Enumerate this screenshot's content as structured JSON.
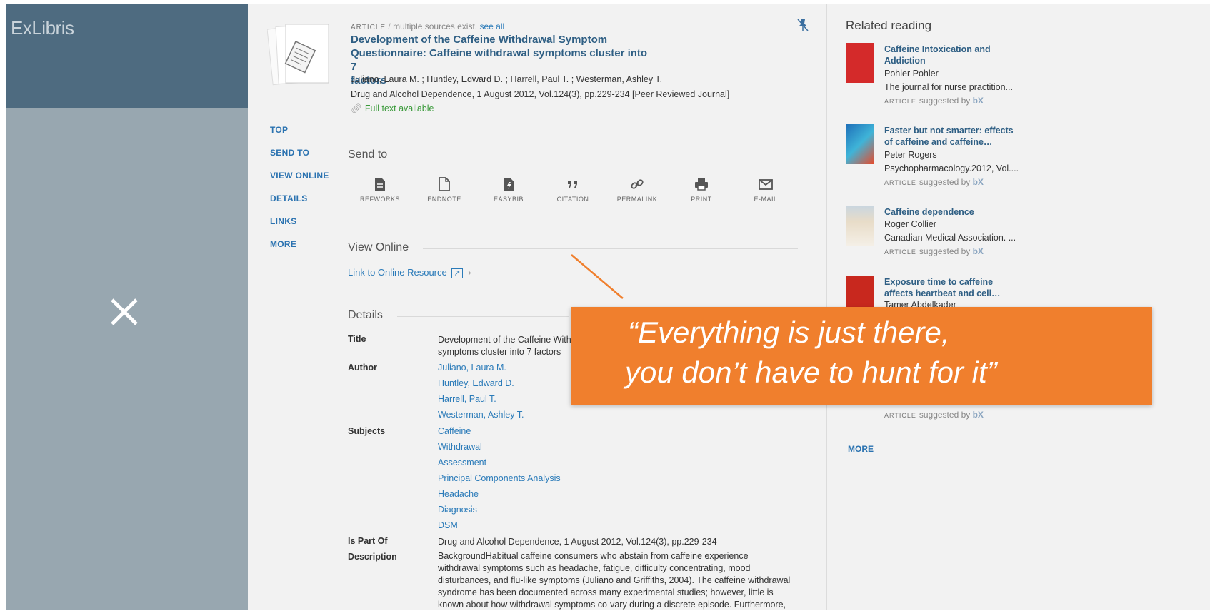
{
  "logo": {
    "text": "ExLibris"
  },
  "record": {
    "type_label": "ARTICLE",
    "sources_text": "multiple sources exist.",
    "see_all": "see all",
    "title_lines": [
      "Development of the Caffeine Withdrawal Symptom",
      "Questionnaire: Caffeine withdrawal symptoms cluster into 7",
      "factors"
    ],
    "authors": "Juliano, Laura M. ; Huntley, Edward D. ; Harrell, Paul T. ; Westerman, Ashley T.",
    "source": "Drug and Alcohol Dependence, 1 August 2012, Vol.124(3), pp.229-234 [Peer Reviewed Journal]",
    "availability": "Full text available"
  },
  "nav": {
    "items": [
      "TOP",
      "SEND TO",
      "VIEW ONLINE",
      "DETAILS",
      "LINKS",
      "MORE"
    ]
  },
  "send_to": {
    "heading": "Send to",
    "items": [
      {
        "label": "REFWORKS",
        "icon": "document-filled-icon"
      },
      {
        "label": "ENDNOTE",
        "icon": "document-outline-icon"
      },
      {
        "label": "EASYBIB",
        "icon": "easybib-icon"
      },
      {
        "label": "CITATION",
        "icon": "quote-icon"
      },
      {
        "label": "PERMALINK",
        "icon": "link-icon"
      },
      {
        "label": "PRINT",
        "icon": "printer-icon"
      },
      {
        "label": "E-MAIL",
        "icon": "mail-icon"
      }
    ]
  },
  "view_online": {
    "heading": "View Online",
    "link": "Link to Online Resource"
  },
  "details": {
    "heading": "Details",
    "title_label": "Title",
    "title_value_lines": [
      "Development of the Caffeine With",
      "symptoms cluster into 7 factors"
    ],
    "author_label": "Author",
    "authors": [
      "Juliano, Laura M.",
      "Huntley, Edward D.",
      "Harrell, Paul T.",
      "Westerman, Ashley T."
    ],
    "subjects_label": "Subjects",
    "subjects": [
      "Caffeine",
      "Withdrawal",
      "Assessment",
      "Principal Components Analysis",
      "Headache",
      "Diagnosis",
      "DSM"
    ],
    "is_part_of_label": "Is Part Of",
    "is_part_of": "Drug and Alcohol Dependence, 1 August 2012, Vol.124(3), pp.229-234",
    "description_label": "Description",
    "description_lines": [
      "BackgroundHabitual caffeine consumers who abstain from caffeine experience",
      "withdrawal symptoms such as headache, fatigue, difficulty concentrating, mood",
      "disturbances, and flu-like symptoms (Juliano and Griffiths, 2004). The caffeine withdrawal",
      "syndrome has been documented across many experimental studies; however, little is",
      "known about how withdrawal symptoms co-vary during a discrete episode. Furthermore,"
    ]
  },
  "related": {
    "heading": "Related reading",
    "items": [
      {
        "title_lines": [
          "Caffeine Intoxication and",
          "Addiction"
        ],
        "author": "Pohler Pohler",
        "source": "The journal for nurse practition...",
        "type": "ARTICLE",
        "suggested": "suggested by",
        "bx": "bX",
        "cover_color": "#d42a2a"
      },
      {
        "title_lines": [
          "Faster but not smarter: effects",
          "of caffeine and caffeine…"
        ],
        "author": "Peter Rogers",
        "source": "Psychopharmacology.2012, Vol....",
        "type": "ARTICLE",
        "suggested": "suggested by",
        "bx": "bX",
        "cover_color": "#1e6fb8"
      },
      {
        "title_lines": [
          "Caffeine dependence"
        ],
        "author": "Roger Collier",
        "source": "Canadian Medical Association. ...",
        "type": "ARTICLE",
        "suggested": "suggested by",
        "bx": "bX",
        "cover_color": "#e8dcc8"
      },
      {
        "title_lines": [
          "Exposure time to caffeine",
          "affects heartbeat and cell…"
        ],
        "author": "Tamer Abdelkader",
        "source": "",
        "type": "",
        "suggested": "",
        "bx": "",
        "cover_color": "#c8281e"
      }
    ],
    "last_type": "ARTICLE",
    "last_suggested": "suggested by",
    "last_bx": "bX",
    "more": "MORE"
  },
  "callout": {
    "line1": "“Everything is just there,",
    "line2": "you don’t have to hunt for it”",
    "color": "#f07f2d"
  }
}
